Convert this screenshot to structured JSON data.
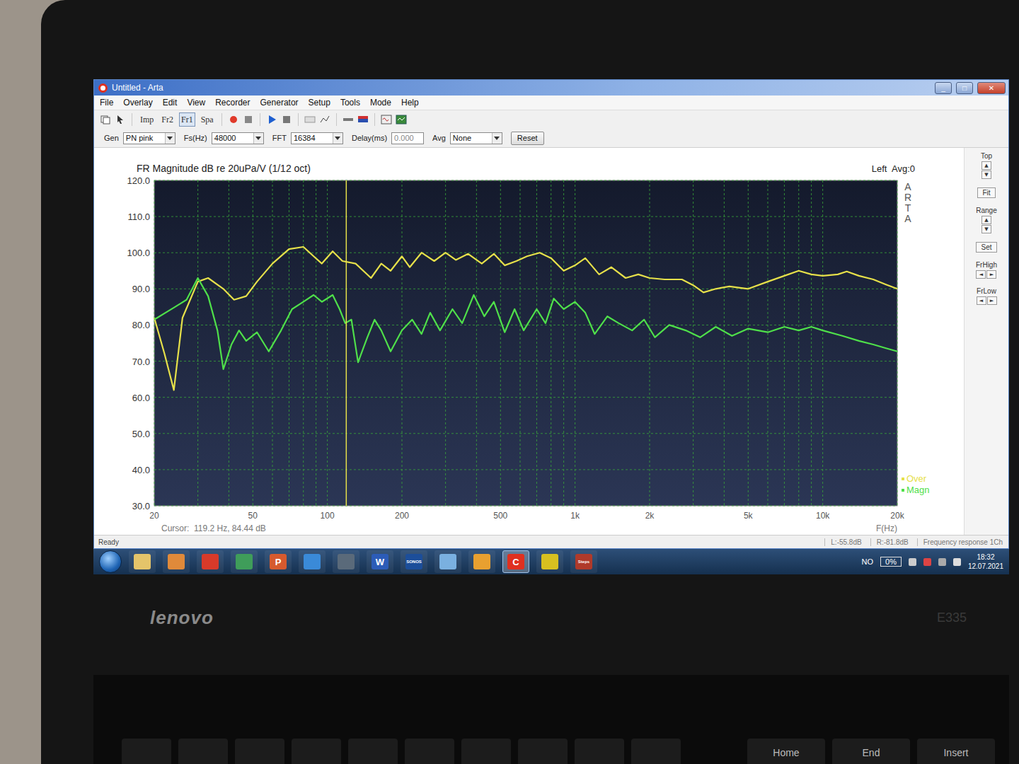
{
  "laptop": {
    "brand": "lenovo",
    "model": "E335"
  },
  "window": {
    "title": "Untitled - Arta",
    "controls": [
      {
        "glyph": "_",
        "kind": "min"
      },
      {
        "glyph": "□",
        "kind": "max"
      },
      {
        "glyph": "✕",
        "kind": "close"
      }
    ]
  },
  "menu": [
    "File",
    "Overlay",
    "Edit",
    "View",
    "Recorder",
    "Generator",
    "Setup",
    "Tools",
    "Mode",
    "Help"
  ],
  "toolbar": {
    "modes": [
      {
        "label": "Imp",
        "selected": false
      },
      {
        "label": "Fr2",
        "selected": false
      },
      {
        "label": "Fr1",
        "selected": true
      },
      {
        "label": "Spa",
        "selected": false
      }
    ]
  },
  "controls": [
    {
      "label": "Gen",
      "value": "PN pink",
      "kind": "select"
    },
    {
      "label": "Fs(Hz)",
      "value": "48000",
      "kind": "select"
    },
    {
      "label": "FFT",
      "value": "16384",
      "kind": "select"
    },
    {
      "label": "Delay(ms)",
      "value": "0.000",
      "kind": "field"
    },
    {
      "label": "Avg",
      "value": "None",
      "kind": "select"
    }
  ],
  "reset": "Reset",
  "chart": {
    "title": "FR Magnitude dB re 20uPa/V (1/12 oct)",
    "channel": "Left  Avg:0",
    "watermark": "ARTA",
    "y_min": 30,
    "y_max": 120,
    "y_ticks": [
      "120.0",
      "110.0",
      "100.0",
      "90.0",
      "80.0",
      "70.0",
      "60.0",
      "50.0",
      "40.0",
      "30.0"
    ],
    "x_min": 20,
    "x_max": 20000,
    "x_ticks": [
      {
        "label": "20",
        "hz": 20
      },
      {
        "label": "50",
        "hz": 50
      },
      {
        "label": "100",
        "hz": 100
      },
      {
        "label": "200",
        "hz": 200
      },
      {
        "label": "500",
        "hz": 500
      },
      {
        "label": "1k",
        "hz": 1000
      },
      {
        "label": "2k",
        "hz": 2000
      },
      {
        "label": "5k",
        "hz": 5000
      },
      {
        "label": "10k",
        "hz": 10000
      },
      {
        "label": "20k",
        "hz": 20000
      }
    ],
    "x_label": "F(Hz)",
    "cursor": {
      "label": "Cursor:",
      "reading": "119.2 Hz, 84.44 dB",
      "hz": 119.2,
      "color": "#e6e04a"
    },
    "series": [
      {
        "name": "Over",
        "color": "#e6e04a",
        "freqs": [
          20,
          22,
          24,
          26,
          30,
          33,
          38,
          42,
          47,
          52,
          60,
          70,
          80,
          88,
          95,
          105,
          115,
          130,
          150,
          165,
          180,
          200,
          215,
          240,
          270,
          300,
          330,
          370,
          420,
          470,
          520,
          580,
          640,
          720,
          800,
          900,
          1000,
          1100,
          1250,
          1400,
          1600,
          1800,
          2000,
          2300,
          2700,
          3000,
          3300,
          3700,
          4200,
          5000,
          6000,
          7000,
          8000,
          9000,
          10000,
          11500,
          12500,
          14000,
          16000,
          18000,
          20000
        ],
        "values": [
          82,
          72,
          62,
          82,
          92,
          93,
          90,
          87,
          88,
          92,
          97,
          101,
          101.6,
          99,
          97,
          100.4,
          97.7,
          97,
          93,
          97,
          95,
          99,
          96,
          100,
          97.7,
          100,
          98,
          99.7,
          97,
          99.7,
          96.5,
          97.7,
          99,
          100,
          98.5,
          95,
          96.5,
          98.5,
          94,
          96,
          93,
          94,
          93,
          92.6,
          92.6,
          91,
          89,
          90,
          90.7,
          90,
          92,
          93.6,
          95,
          94,
          93.6,
          94,
          94.8,
          93.6,
          92.6,
          91.2,
          90
        ]
      },
      {
        "name": "Magn",
        "color": "#4fe04a",
        "freqs": [
          20,
          24,
          27,
          30,
          33,
          36,
          38,
          41,
          44,
          47,
          52,
          58,
          65,
          72,
          80,
          88,
          95,
          105,
          112,
          118,
          125,
          133,
          145,
          155,
          165,
          180,
          200,
          220,
          240,
          260,
          285,
          320,
          350,
          390,
          430,
          470,
          520,
          570,
          620,
          700,
          760,
          820,
          900,
          1000,
          1100,
          1200,
          1350,
          1500,
          1700,
          1900,
          2100,
          2400,
          2800,
          3200,
          3700,
          4300,
          5000,
          6000,
          7000,
          8000,
          9000,
          10000,
          12000,
          14000,
          16000,
          18000,
          20000
        ],
        "values": [
          81.5,
          84.8,
          87,
          93,
          88,
          78.5,
          67.8,
          74.6,
          78.5,
          75.6,
          78,
          72.7,
          78.5,
          84.4,
          86.4,
          88.3,
          86.4,
          88.3,
          84.4,
          80.5,
          81.5,
          69.7,
          76.6,
          81.5,
          78.5,
          72.7,
          78.5,
          81.5,
          77.5,
          83.4,
          78.5,
          84.4,
          80.5,
          88.3,
          82.4,
          86.4,
          78,
          84.4,
          78.5,
          84.4,
          80.5,
          87.3,
          84.4,
          86.4,
          83.4,
          77.5,
          82.4,
          80.5,
          78.5,
          81.5,
          76.6,
          80,
          78.5,
          76.6,
          79.5,
          77,
          79,
          78,
          79.5,
          78.5,
          79.5,
          78.5,
          77,
          75.6,
          74.6,
          73.6,
          72.7
        ]
      }
    ]
  },
  "side_panel": {
    "arrows": {
      "up": "▲",
      "down": "▼",
      "left": "◄",
      "right": "►"
    },
    "items": [
      {
        "label": "Top",
        "kind": "updown"
      },
      {
        "label": "Fit",
        "kind": "button"
      },
      {
        "label": "Range",
        "kind": "updown"
      },
      {
        "label": "Set",
        "kind": "button"
      },
      {
        "label": "FrHigh",
        "kind": "leftright"
      },
      {
        "label": "FrLow",
        "kind": "leftright"
      }
    ]
  },
  "status_bar": {
    "left": "Ready",
    "fields": [
      "L:-55.8dB",
      "R:-81.8dB",
      "Frequency response 1Ch"
    ]
  },
  "taskbar": {
    "apps": [
      {
        "label": "",
        "color": "#e4c46a",
        "selected": false
      },
      {
        "label": "",
        "color": "#e08a3a",
        "selected": false
      },
      {
        "label": "",
        "color": "#d83a2a",
        "selected": false
      },
      {
        "label": "",
        "color": "#3f9d5a",
        "selected": false
      },
      {
        "label": "P",
        "color": "#d65a2e",
        "selected": false
      },
      {
        "label": "",
        "color": "#3a8ad8",
        "selected": false
      },
      {
        "label": "",
        "color": "#5a6a7a",
        "selected": false
      },
      {
        "label": "W",
        "color": "#2c5cb8",
        "selected": false
      },
      {
        "label": "SONOS",
        "color": "#1c4e9a",
        "selected": false
      },
      {
        "label": "",
        "color": "#7ab0e0",
        "selected": false
      },
      {
        "label": "",
        "color": "#e8a030",
        "selected": false
      },
      {
        "label": "C",
        "color": "#e03020",
        "selected": true
      },
      {
        "label": "",
        "color": "#d8c020",
        "selected": false
      },
      {
        "label": "Steps",
        "color": "#b03a2a",
        "selected": false
      }
    ],
    "language": "NO",
    "battery": "0%",
    "time": "18:32",
    "date": "12.07.2021"
  },
  "keyboard": [
    "Home",
    "End",
    "Insert"
  ]
}
